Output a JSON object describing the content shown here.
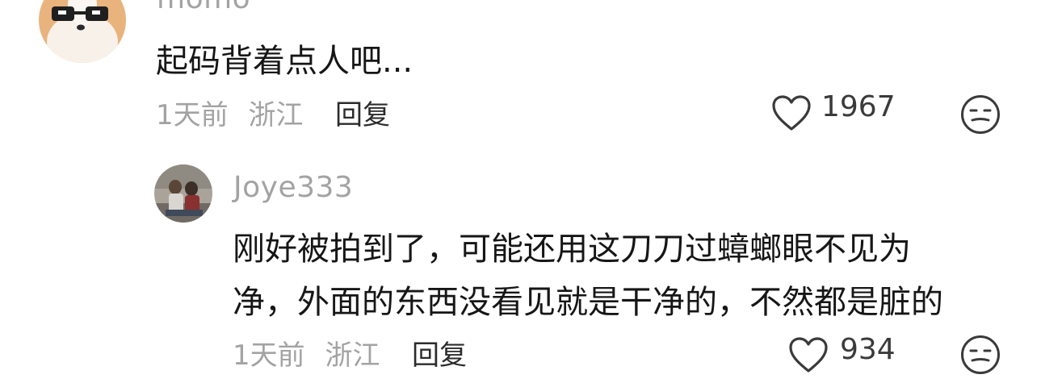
{
  "comments": [
    {
      "username": "momo",
      "avatar_icon": "dog-with-sunglasses-avatar",
      "text_lines": [
        "起码背着点人吧..."
      ],
      "time": "1天前",
      "location": "浙江",
      "reply_label": "回复",
      "likes": "1967"
    },
    {
      "username": "Joye333",
      "avatar_icon": "photo-avatar",
      "text_lines": [
        "刚好被拍到了，可能还用这刀刀过蟑螂眼不见为",
        "净，外面的东西没看见就是干净的，不然都是脏的"
      ],
      "time": "1天前",
      "location": "浙江",
      "reply_label": "回复",
      "likes": "934"
    }
  ],
  "colors": {
    "meta_gray": "#a3a3a3",
    "text_dark": "#161616",
    "icon_dark": "#3a3a3a"
  }
}
